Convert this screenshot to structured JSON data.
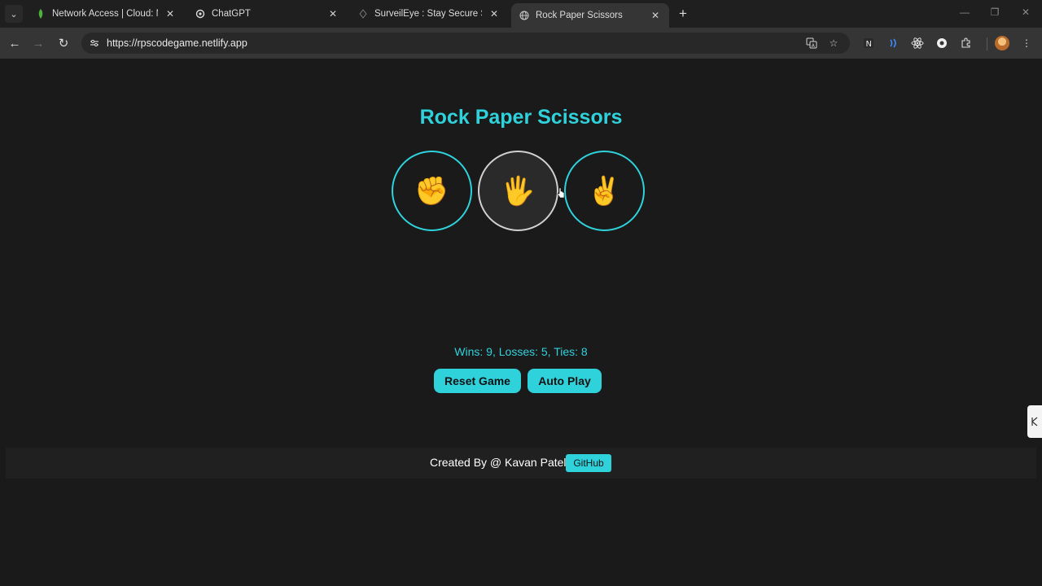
{
  "browser": {
    "tabs": [
      {
        "title": "Network Access | Cloud: MongoDB",
        "favicon": "mongodb-leaf-icon",
        "color": "#4db33d"
      },
      {
        "title": "ChatGPT",
        "favicon": "chatgpt-icon"
      },
      {
        "title": "SurveilEye : Stay Secure Stay Smart",
        "favicon": "surveileye-icon"
      },
      {
        "title": "Rock Paper Scissors",
        "favicon": "globe-icon",
        "active": true
      }
    ],
    "url": "https://rpscodegame.netlify.app",
    "window_controls": [
      "minimize",
      "restore",
      "close"
    ]
  },
  "page": {
    "title": "Rock Paper Scissors",
    "accent_color": "#2fd2db",
    "background_color": "#1a1a1a",
    "choices": [
      {
        "name": "rock",
        "emoji": "✊"
      },
      {
        "name": "paper",
        "emoji": "🖐",
        "hovered": true
      },
      {
        "name": "scissors",
        "emoji": "✌"
      }
    ],
    "score_text": "Wins: 9, Losses: 5, Ties: 8",
    "reset_label": "Reset Game",
    "autoplay_label": "Auto Play",
    "footer_credit": "Created By @ Kavan Patel",
    "github_label": "GitHub"
  }
}
